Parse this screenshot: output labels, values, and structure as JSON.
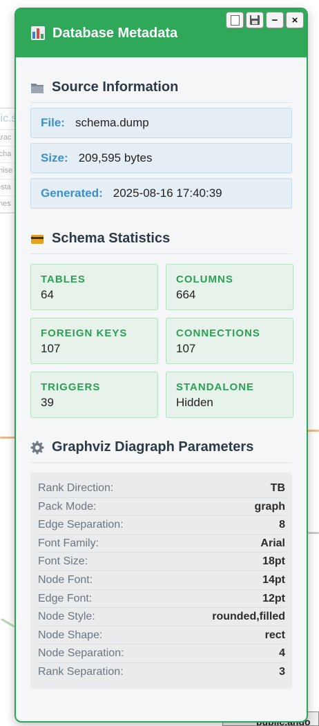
{
  "window": {
    "title": "Database Metadata",
    "buttons": {
      "notes": "notes-icon",
      "save": "save-icon",
      "minimize": "−",
      "close": "×"
    }
  },
  "background": {
    "frag_header": "lic.s",
    "frag_rows": [
      "arac",
      "(cha",
      "mise",
      "esta",
      "mes"
    ],
    "bottom_label": "public.ando"
  },
  "source": {
    "heading": "Source Information",
    "icon": "folder-icon",
    "file_label": "File:",
    "file_value": "schema.dump",
    "size_label": "Size:",
    "size_value": "209,595 bytes",
    "generated_label": "Generated:",
    "generated_value": "2025-08-16 17:40:39"
  },
  "stats": {
    "heading": "Schema Statistics",
    "icon": "card-icon",
    "cards": [
      {
        "label": "TABLES",
        "value": "64"
      },
      {
        "label": "COLUMNS",
        "value": "664"
      },
      {
        "label": "FOREIGN KEYS",
        "value": "107"
      },
      {
        "label": "CONNECTIONS",
        "value": "107"
      },
      {
        "label": "TRIGGERS",
        "value": "39"
      },
      {
        "label": "STANDALONE",
        "value": "Hidden"
      }
    ]
  },
  "graphviz": {
    "heading": "Graphviz Diagraph Parameters",
    "icon": "gear-icon",
    "params": [
      {
        "label": "Rank Direction:",
        "value": "TB"
      },
      {
        "label": "Pack Mode:",
        "value": "graph"
      },
      {
        "label": "Edge Separation:",
        "value": "8"
      },
      {
        "label": "Font Family:",
        "value": "Arial"
      },
      {
        "label": "Font Size:",
        "value": "18pt"
      },
      {
        "label": "Node Font:",
        "value": "14pt"
      },
      {
        "label": "Edge Font:",
        "value": "12pt"
      },
      {
        "label": "Node Style:",
        "value": "rounded,filled"
      },
      {
        "label": "Node Shape:",
        "value": "rect"
      },
      {
        "label": "Node Separation:",
        "value": "4"
      },
      {
        "label": "Rank Separation:",
        "value": "3"
      }
    ]
  },
  "colors": {
    "accent": "#2fa85a",
    "info_label": "#3a8fd0",
    "stat_label": "#2aa055"
  }
}
